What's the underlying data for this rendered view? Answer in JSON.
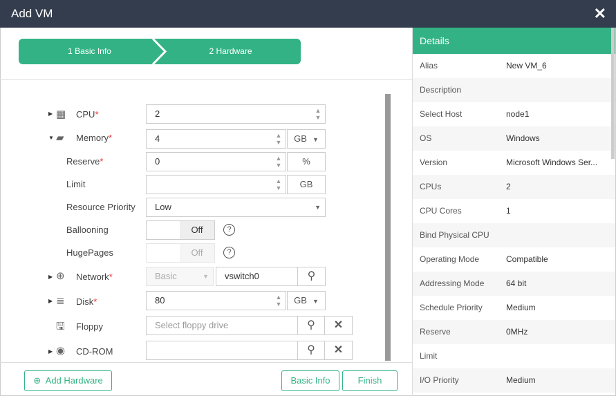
{
  "title": "Add VM",
  "steps": [
    "1 Basic Info",
    "2 Hardware"
  ],
  "form": {
    "cpu": {
      "label": "CPU",
      "value": "2"
    },
    "memory": {
      "label": "Memory",
      "value": "4",
      "unit": "GB"
    },
    "reserve": {
      "label": "Reserve",
      "value": "0",
      "unit": "%"
    },
    "limit": {
      "label": "Limit",
      "value": "",
      "unit": "GB"
    },
    "priority": {
      "label": "Resource Priority",
      "value": "Low"
    },
    "ballooning": {
      "label": "Ballooning",
      "value": "Off"
    },
    "hugepages": {
      "label": "HugePages",
      "value": "Off"
    },
    "network": {
      "label": "Network",
      "type": "Basic",
      "value": "vswitch0"
    },
    "disk": {
      "label": "Disk",
      "value": "80",
      "unit": "GB"
    },
    "floppy": {
      "label": "Floppy",
      "placeholder": "Select floppy drive"
    },
    "cdrom": {
      "label": "CD-ROM",
      "value": ""
    }
  },
  "req": "*",
  "footer": {
    "add": "Add Hardware",
    "basic": "Basic Info",
    "finish": "Finish"
  },
  "details": {
    "title": "Details",
    "rows": [
      {
        "k": "Alias",
        "v": "New VM_6"
      },
      {
        "k": "Description",
        "v": ""
      },
      {
        "k": "Select Host",
        "v": "node1"
      },
      {
        "k": "OS",
        "v": "Windows"
      },
      {
        "k": "Version",
        "v": "Microsoft Windows Ser..."
      },
      {
        "k": "CPUs",
        "v": "2"
      },
      {
        "k": "CPU Cores",
        "v": "1"
      },
      {
        "k": "Bind Physical CPU",
        "v": ""
      },
      {
        "k": "Operating Mode",
        "v": "Compatible"
      },
      {
        "k": "Addressing Mode",
        "v": "64 bit"
      },
      {
        "k": "Schedule Priority",
        "v": "Medium"
      },
      {
        "k": "Reserve",
        "v": "0MHz"
      },
      {
        "k": "Limit",
        "v": ""
      },
      {
        "k": "I/O Priority",
        "v": "Medium"
      }
    ]
  }
}
